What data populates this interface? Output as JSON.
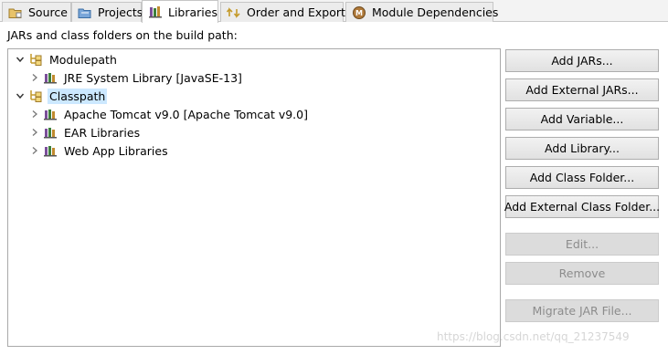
{
  "tabs": [
    {
      "label": "Source",
      "icon": "source-folder-icon",
      "active": false
    },
    {
      "label": "Projects",
      "icon": "projects-folder-icon",
      "active": false
    },
    {
      "label": "Libraries",
      "icon": "libraries-icon",
      "active": true
    },
    {
      "label": "Order and Export",
      "icon": "order-export-icon",
      "active": false
    },
    {
      "label": "Module Dependencies",
      "icon": "module-dependencies-icon",
      "active": false
    }
  ],
  "heading": "JARs and class folders on the build path:",
  "tree": {
    "items": [
      {
        "label": "Modulepath",
        "expanded": true,
        "level": 0,
        "icon": "classpath-container-icon"
      },
      {
        "label": "JRE System Library [JavaSE-13]",
        "expanded": false,
        "level": 1,
        "icon": "library-icon"
      },
      {
        "label": "Classpath",
        "expanded": true,
        "level": 0,
        "icon": "classpath-container-icon",
        "selected": true
      },
      {
        "label": "Apache Tomcat v9.0 [Apache Tomcat v9.0]",
        "expanded": false,
        "level": 1,
        "icon": "library-icon"
      },
      {
        "label": "EAR Libraries",
        "expanded": false,
        "level": 1,
        "icon": "library-icon"
      },
      {
        "label": "Web App Libraries",
        "expanded": false,
        "level": 1,
        "icon": "library-icon"
      }
    ]
  },
  "buttons": {
    "add_jars": "Add JARs...",
    "add_external_jars": "Add External JARs...",
    "add_variable": "Add Variable...",
    "add_library": "Add Library...",
    "add_class_folder": "Add Class Folder...",
    "add_external_class_folder": "Add External Class Folder...",
    "edit": "Edit...",
    "remove": "Remove",
    "migrate_jar": "Migrate JAR File..."
  },
  "watermark": "https://blog.csdn.net/qq_21237549",
  "colors": {
    "selection": "#cce8ff",
    "disabled_text": "#8c8c8c",
    "border": "#a9a9a9"
  }
}
